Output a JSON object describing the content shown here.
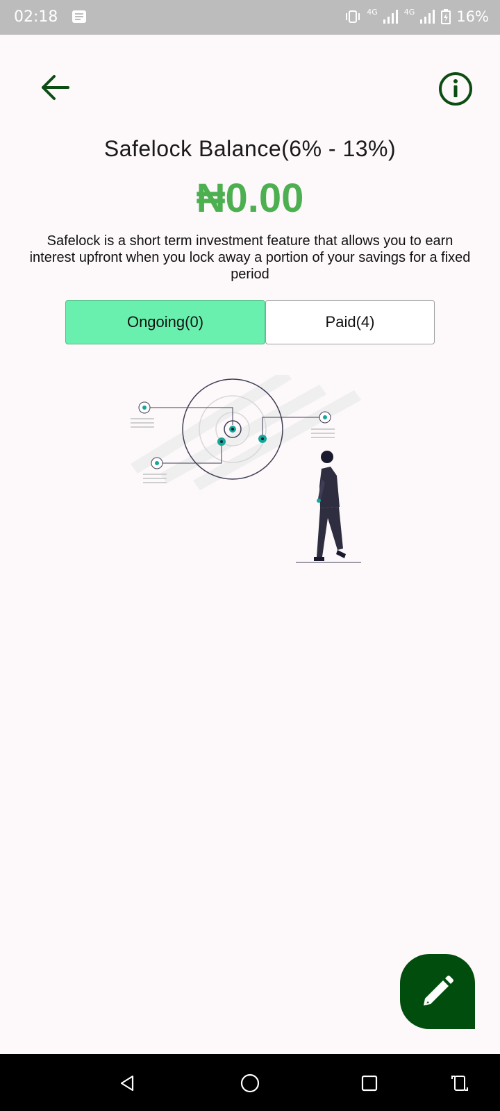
{
  "status_bar": {
    "time": "02:18",
    "net1": "4G",
    "net2": "4G",
    "battery": "16%"
  },
  "header": {
    "back_icon": "arrow-left-icon",
    "info_icon": "info-circle-icon",
    "accent_color": "#0b4d14"
  },
  "main": {
    "title": "Safelock Balance(6% - 13%)",
    "balance": "₦0.00",
    "balance_color": "#4caf50",
    "description": "Safelock is a short term investment feature that allows you to earn interest upfront when you lock away a portion of your savings for a fixed period",
    "tabs": [
      {
        "label": "Ongoing(0)",
        "active": true
      },
      {
        "label": "Paid(4)",
        "active": false
      }
    ],
    "active_tab_color": "#69f0ae",
    "illustration": "empty-state-illustration"
  },
  "fab": {
    "icon": "pencil-icon",
    "color": "#004d0d"
  },
  "nav": {
    "back_icon": "nav-back-icon",
    "home_icon": "nav-home-icon",
    "recents_icon": "nav-recents-icon",
    "rotate_icon": "rotate-icon"
  }
}
